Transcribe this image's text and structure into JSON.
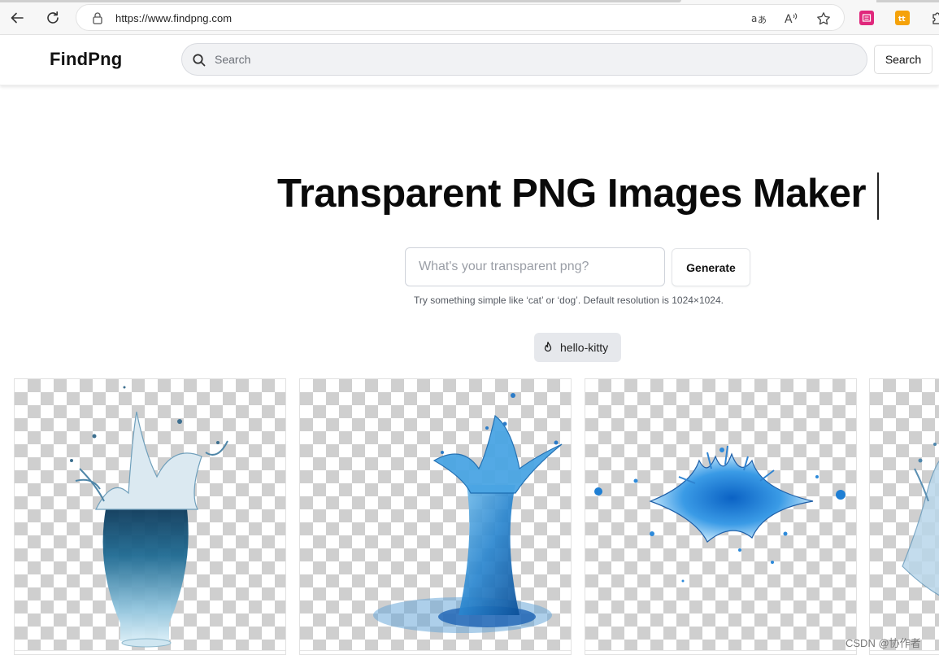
{
  "browser": {
    "url": "https://www.findpng.com"
  },
  "header": {
    "logo": "FindPng",
    "search_placeholder": "Search",
    "search_button": "Search"
  },
  "hero": {
    "title": "Transparent PNG Images Maker",
    "input_placeholder": "What's your transparent png?",
    "generate_button": "Generate",
    "hint": "Try something simple like ‘cat’ or ‘dog’. Default resolution is 1024×1024."
  },
  "tags": [
    {
      "label": "hello-kitty",
      "icon": "flame-icon"
    }
  ],
  "gallery": [
    {
      "icon": "water-splash-glass-image"
    },
    {
      "icon": "water-splash-column-image"
    },
    {
      "icon": "water-splash-crown-image"
    },
    {
      "icon": "water-splash-partial-image"
    }
  ],
  "watermark": "CSDN @协作者"
}
